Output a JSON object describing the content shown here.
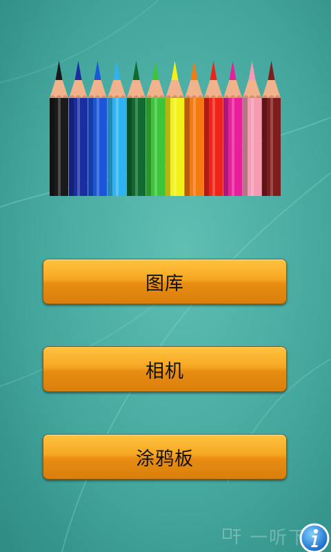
{
  "menu": {
    "gallery_label": "图库",
    "camera_label": "相机",
    "doodle_label": "涂鸦板"
  },
  "watermark": {
    "text": "一听下载"
  },
  "icons": {
    "banner": "colored-pencils-icon",
    "watermark": "listen-icon",
    "info": "info-icon"
  },
  "colors": {
    "background_light": "#5fbfb3",
    "background_dark": "#2f8d86",
    "button_top": "#ffc340",
    "button_bottom": "#d97f0b",
    "pencils": [
      "#1a1a1a",
      "#1a2ea0",
      "#1b55d8",
      "#2fb3f0",
      "#0f6b2f",
      "#3cc43a",
      "#f2f21a",
      "#f57a12",
      "#ee2417",
      "#e81f9a",
      "#f59bb3",
      "#7d1d1d"
    ]
  }
}
